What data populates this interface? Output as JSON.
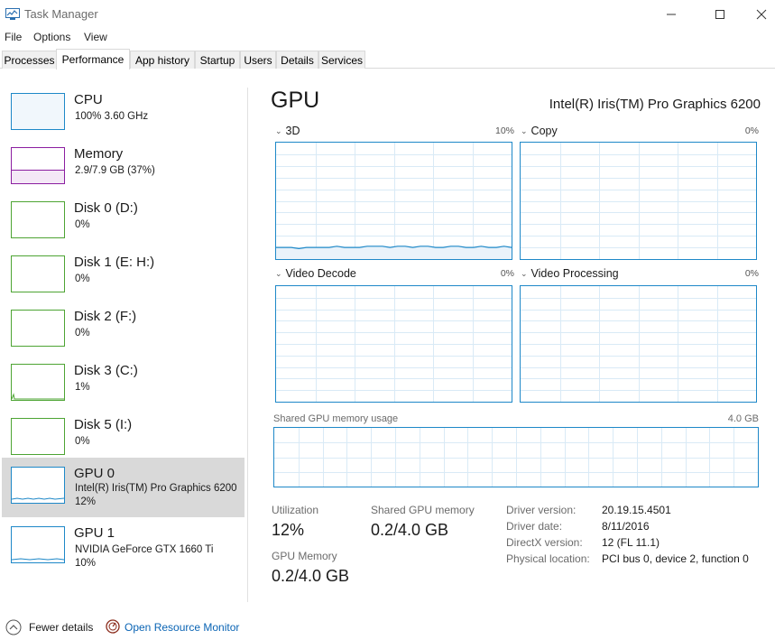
{
  "window": {
    "title": "Task Manager"
  },
  "menu": [
    "File",
    "Options",
    "View"
  ],
  "tabs": [
    "Processes",
    "Performance",
    "App history",
    "Startup",
    "Users",
    "Details",
    "Services"
  ],
  "active_tab": "Performance",
  "sidebar": {
    "items": [
      {
        "name": "CPU",
        "sub1": "100% 3.60 GHz",
        "sub2": "",
        "color": "#1e88c8"
      },
      {
        "name": "Memory",
        "sub1": "2.9/7.9 GB (37%)",
        "sub2": "",
        "color": "#8b1ea0"
      },
      {
        "name": "Disk 0 (D:)",
        "sub1": "0%",
        "sub2": "",
        "color": "#4da433"
      },
      {
        "name": "Disk 1 (E: H:)",
        "sub1": "0%",
        "sub2": "",
        "color": "#4da433"
      },
      {
        "name": "Disk 2 (F:)",
        "sub1": "0%",
        "sub2": "",
        "color": "#4da433"
      },
      {
        "name": "Disk 3 (C:)",
        "sub1": "1%",
        "sub2": "",
        "color": "#4da433"
      },
      {
        "name": "Disk 5 (I:)",
        "sub1": "0%",
        "sub2": "",
        "color": "#4da433"
      },
      {
        "name": "GPU 0",
        "sub1": "Intel(R) Iris(TM) Pro Graphics 6200",
        "sub2": "12%",
        "color": "#1e88c8"
      },
      {
        "name": "GPU 1",
        "sub1": "NVIDIA GeForce GTX 1660 Ti",
        "sub2": "10%",
        "color": "#1e88c8"
      }
    ]
  },
  "gpu": {
    "title": "GPU",
    "model": "Intel(R) Iris(TM) Pro Graphics 6200",
    "engines": [
      {
        "label": "3D",
        "pct": "10%"
      },
      {
        "label": "Copy",
        "pct": "0%"
      },
      {
        "label": "Video Decode",
        "pct": "0%"
      },
      {
        "label": "Video Processing",
        "pct": "0%"
      }
    ],
    "shared_memory": {
      "label": "Shared GPU memory usage",
      "max": "4.0 GB"
    },
    "stats": {
      "utilization_label": "Utilization",
      "utilization_value": "12%",
      "shared_label": "Shared GPU memory",
      "shared_value": "0.2/4.0 GB",
      "gpu_memory_label": "GPU Memory",
      "gpu_memory_value": "0.2/4.0 GB"
    },
    "info": [
      {
        "key": "Driver version:",
        "value": "20.19.15.4501"
      },
      {
        "key": "Driver date:",
        "value": "8/11/2016"
      },
      {
        "key": "DirectX version:",
        "value": "12 (FL 11.1)"
      },
      {
        "key": "Physical location:",
        "value": "PCI bus 0, device 2, function 0"
      }
    ]
  },
  "footer": {
    "fewer_details": "Fewer details",
    "open_resource_monitor": "Open Resource Monitor"
  },
  "colors": {
    "accent_blue": "#1e88c8",
    "memory_purple": "#8b1ea0",
    "disk_green": "#4da433",
    "link_blue": "#0a64b4"
  }
}
